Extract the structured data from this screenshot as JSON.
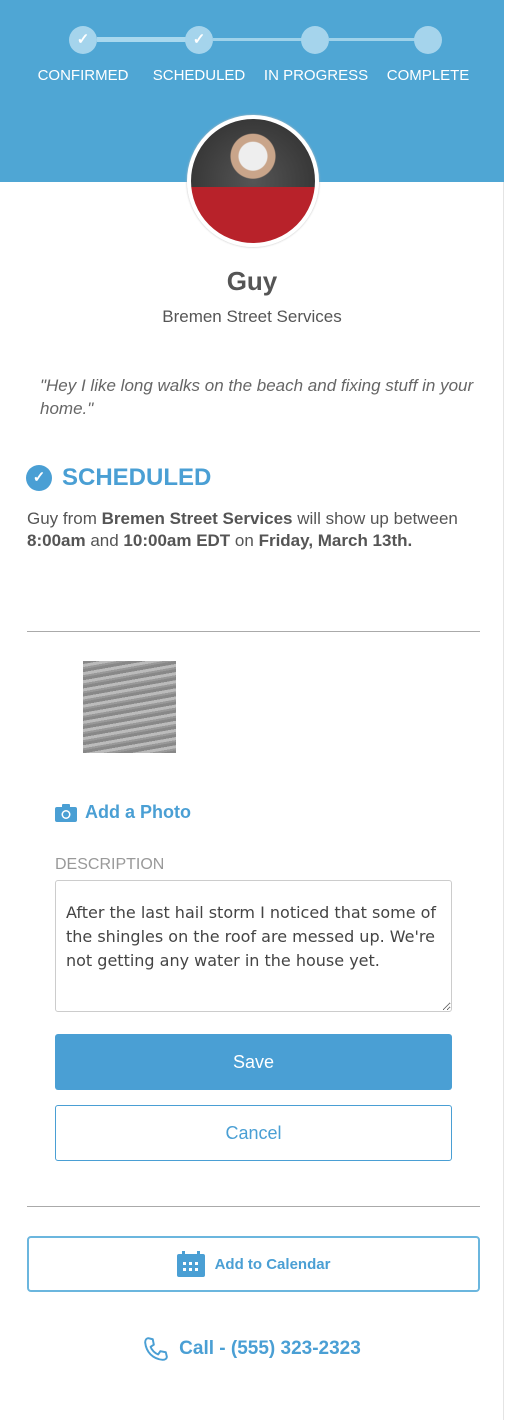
{
  "steps": [
    {
      "label": "CONFIRMED",
      "done": true
    },
    {
      "label": "SCHEDULED",
      "done": true
    },
    {
      "label": "IN PROGRESS",
      "done": false
    },
    {
      "label": "COMPLETE",
      "done": false
    }
  ],
  "provider": {
    "name": "Guy",
    "company": "Bremen Street Services",
    "quote": "\"Hey I like long walks on the beach and fixing stuff in your home.\""
  },
  "status": {
    "title": "SCHEDULED",
    "p1": "Guy from ",
    "company": "Bremen Street Services",
    "p2": " will show up between ",
    "start": "8:00am",
    "p3": " and ",
    "end": "10:00am EDT",
    "p4": " on ",
    "date": "Friday, March 13th."
  },
  "add_photo": "Add a Photo",
  "description": {
    "label": "DESCRIPTION",
    "value": "After the last hail storm I noticed that some of the shingles on the roof are messed up. We're not getting any water in the house yet."
  },
  "save_label": "Save",
  "cancel_label": "Cancel",
  "calendar_label": "Add to Calendar",
  "call_label": "Call - (555) 323-2323",
  "colors": {
    "header": "#4FA6D4",
    "accent": "#4A9FD4"
  }
}
